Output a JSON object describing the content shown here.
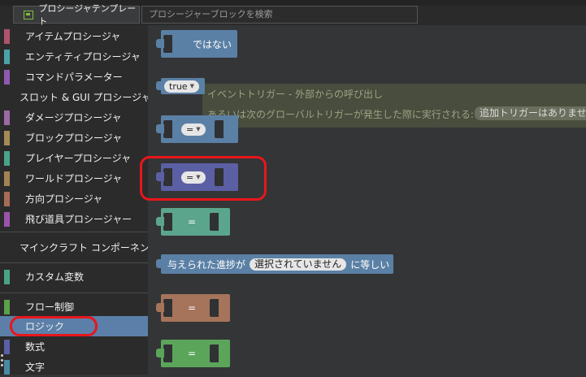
{
  "tabs": {
    "template_tab": "プロシージャテンプレート",
    "template_icon": "block-template-icon",
    "search_placeholder": "プロシージャーブロックを検索"
  },
  "sidebar": {
    "items": [
      {
        "label": "アイテムプロシージャ",
        "color": "#b1546b"
      },
      {
        "label": "エンティティプロシージャ",
        "color": "#4aa3a8"
      },
      {
        "label": "コマンドパラメーター",
        "color": "#8f5ab1"
      },
      {
        "label": "スロット & GUI プロシージャ",
        "color": "#6aa14a"
      },
      {
        "label": "ダメージプロシージャ",
        "color": "#9b6aa5"
      },
      {
        "label": "ブロックプロシージャ",
        "color": "#a58a55"
      },
      {
        "label": "プレイヤープロシージャ",
        "color": "#4aa38a"
      },
      {
        "label": "ワールドプロシージャ",
        "color": "#a38355"
      },
      {
        "label": "方向プロシージャ",
        "color": "#a56d55"
      },
      {
        "label": "飛び道具プロシージャー",
        "color": "#9b55a8"
      },
      {
        "label": "マインクラフト コンポーネント",
        "color": "#b1546b"
      },
      {
        "label": "カスタム変数",
        "color": "#4aa384"
      },
      {
        "label": "フロー制御",
        "color": "#5aa14a"
      },
      {
        "label": "ロジック",
        "color": "#5b7fa8"
      },
      {
        "label": "数式",
        "color": "#5a5fa8"
      },
      {
        "label": "文字",
        "color": "#4a8aa3"
      }
    ]
  },
  "workspace": {
    "not_label": "ではない",
    "true_label": "true",
    "eq1": "=",
    "eq2": "=",
    "eq3": "=",
    "eq4": "=",
    "eq5": "=",
    "advancement_prefix": "与えられた進捗が",
    "advancement_value": "選択されていません",
    "advancement_suffix": "に等しい",
    "comment_line1": "イベントトリガー - 外部からの呼び出し",
    "comment_line2": "あるいは次のグローバルトリガーが発生した際に実行される:",
    "comment_pill": "追加トリガーはありません"
  },
  "colors": {
    "logic": "#5b80a5",
    "logic_selected": "#5b5fa3",
    "variable": "#5ba58c",
    "direction": "#a5745b",
    "flow": "#5ba55b",
    "highlight": "#e8161b"
  }
}
